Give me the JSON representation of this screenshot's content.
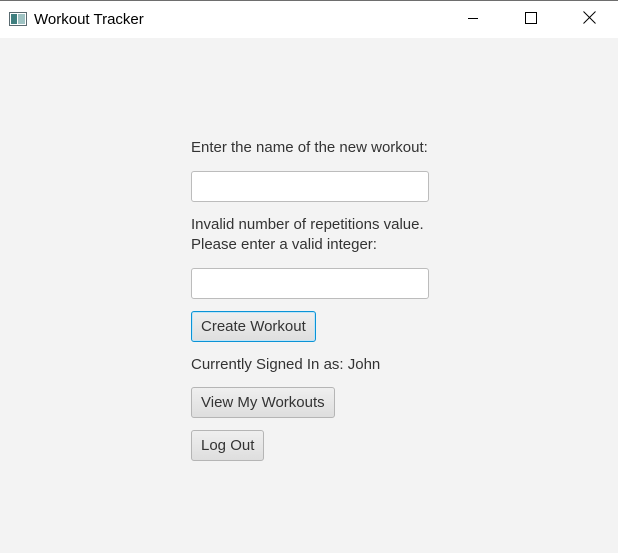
{
  "window": {
    "title": "Workout Tracker",
    "app_icon": "java-window-icon",
    "controls": {
      "minimize_icon": "minimize-icon",
      "maximize_icon": "maximize-icon",
      "close_icon": "close-icon"
    }
  },
  "form": {
    "workout_name_label": "Enter the name of the new workout:",
    "workout_name_value": "",
    "repetitions_error_line1": "Invalid number of repetitions value.",
    "repetitions_error_line2": "Please enter a valid integer:",
    "repetitions_value": "",
    "create_button_label": "Create Workout"
  },
  "session": {
    "signed_in_text": "Currently Signed In as: John",
    "view_workouts_label": "View My Workouts",
    "logout_label": "Log Out"
  },
  "colors": {
    "background": "#f3f3f3",
    "titlebar": "#ffffff",
    "focus_accent": "#0a93d6"
  }
}
